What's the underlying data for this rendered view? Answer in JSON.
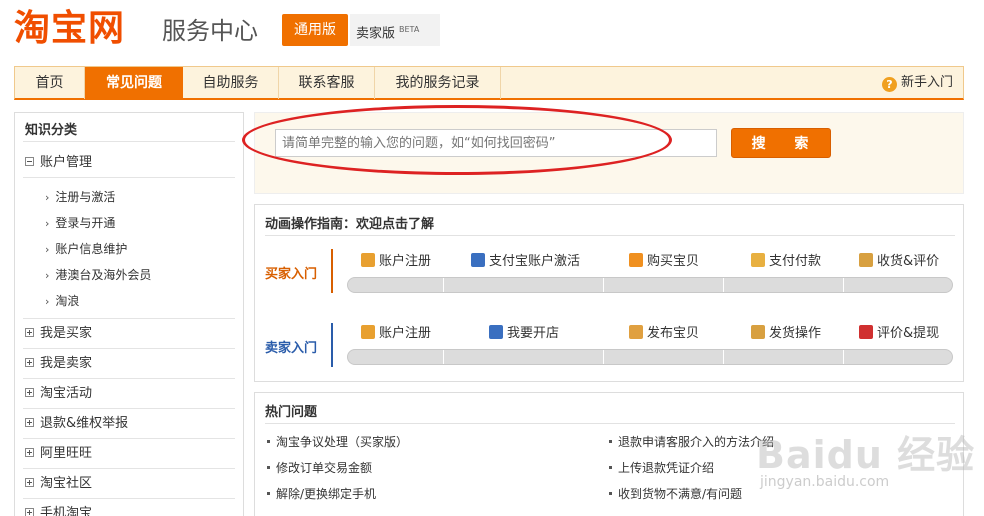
{
  "header": {
    "logo": "淘宝网",
    "subtitle": "服务中心",
    "version_active": "通用版",
    "version_seller": "卖家版",
    "beta": "BETA"
  },
  "nav": {
    "items": [
      "首页",
      "常见问题",
      "自助服务",
      "联系客服",
      "我的服务记录"
    ],
    "active_index": 1,
    "help": "新手入门"
  },
  "sidebar": {
    "heading": "知识分类",
    "expanded": "账户管理",
    "subitems": [
      "注册与激活",
      "登录与开通",
      "账户信息维护",
      "港澳台及海外会员",
      "淘浪"
    ],
    "categories": [
      "我是买家",
      "我是卖家",
      "淘宝活动",
      "退款&维权举报",
      "阿里旺旺",
      "淘宝社区",
      "手机淘宝"
    ]
  },
  "search": {
    "placeholder": "请简单完整的输入您的问题，如“如何找回密码”",
    "button": "搜 索"
  },
  "guide": {
    "title": "动画操作指南：欢迎点击了解",
    "buyer_label": "买家入门",
    "buyer_steps": [
      "账户注册",
      "支付宝账户激活",
      "购买宝贝",
      "支付付款",
      "收货&评价"
    ],
    "seller_label": "卖家入门",
    "seller_steps": [
      "账户注册",
      "我要开店",
      "发布宝贝",
      "发货操作",
      "评价&提现"
    ]
  },
  "hot": {
    "title": "热门问题",
    "left": [
      "淘宝争议处理（买家版）",
      "修改订单交易金额",
      "解除/更换绑定手机"
    ],
    "right": [
      "退款申请客服介入的方法介绍",
      "上传退款凭证介绍",
      "收到货物不满意/有问题"
    ]
  },
  "watermark": {
    "main": "Baidu 经验",
    "sub": "jingyan.baidu.com"
  },
  "colors": {
    "accent": "#f07000",
    "buyer": "#d85f00",
    "seller": "#2a5caa",
    "annotation": "#dd2222"
  }
}
